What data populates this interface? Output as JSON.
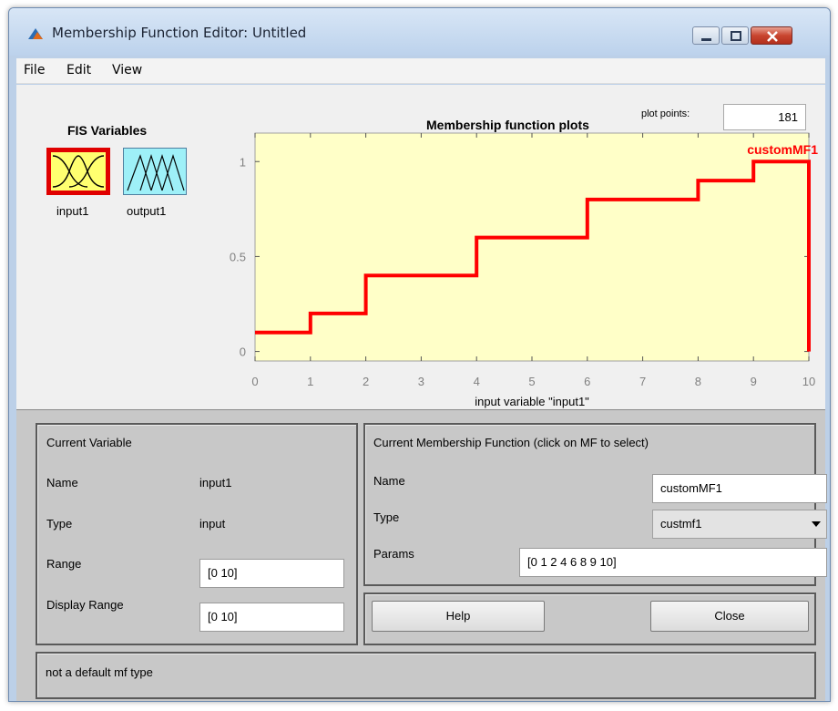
{
  "window": {
    "title": "Membership Function Editor: Untitled"
  },
  "menu": [
    "File",
    "Edit",
    "View"
  ],
  "fis": {
    "heading": "FIS Variables",
    "vars": [
      {
        "label": "input1",
        "selected": true,
        "color": "#ffff70"
      },
      {
        "label": "output1",
        "selected": false,
        "color": "#9ef0f8"
      }
    ]
  },
  "plot": {
    "title": "Membership function plots",
    "plot_points_label": "plot points:",
    "plot_points_value": "181",
    "background": "#ffffc8",
    "line_color": "#ff0000"
  },
  "chart_data": {
    "type": "line",
    "title": "Membership function plots",
    "xlabel": "input variable \"input1\"",
    "ylabel": "",
    "xlim": [
      0,
      10
    ],
    "ylim": [
      -0.05,
      1.15
    ],
    "x_ticks": [
      "0",
      "1",
      "2",
      "3",
      "4",
      "5",
      "6",
      "7",
      "8",
      "9",
      "10"
    ],
    "y_ticks": [
      "0",
      "0.5",
      "1"
    ],
    "series": [
      {
        "name": "customMF1",
        "x": [
          0,
          1,
          1,
          2,
          2,
          4,
          4,
          6,
          6,
          8,
          8,
          9,
          9,
          10,
          10
        ],
        "y": [
          0.1,
          0.1,
          0.2,
          0.2,
          0.4,
          0.4,
          0.6,
          0.6,
          0.8,
          0.8,
          0.9,
          0.9,
          1.0,
          1.0,
          0.0
        ]
      }
    ]
  },
  "current_variable": {
    "heading": "Current Variable",
    "name_label": "Name",
    "name_value": "input1",
    "type_label": "Type",
    "type_value": "input",
    "range_label": "Range",
    "range_value": "[0 10]",
    "display_range_label": "Display Range",
    "display_range_value": "[0 10]"
  },
  "current_mf": {
    "heading": "Current Membership Function (click on MF to select)",
    "name_label": "Name",
    "name_value": "customMF1",
    "type_label": "Type",
    "type_value": "custmf1",
    "params_label": "Params",
    "params_value": "[0 1 2 4 6 8 9 10]"
  },
  "buttons": {
    "help": "Help",
    "close": "Close"
  },
  "status": {
    "message": "not a default mf type"
  }
}
